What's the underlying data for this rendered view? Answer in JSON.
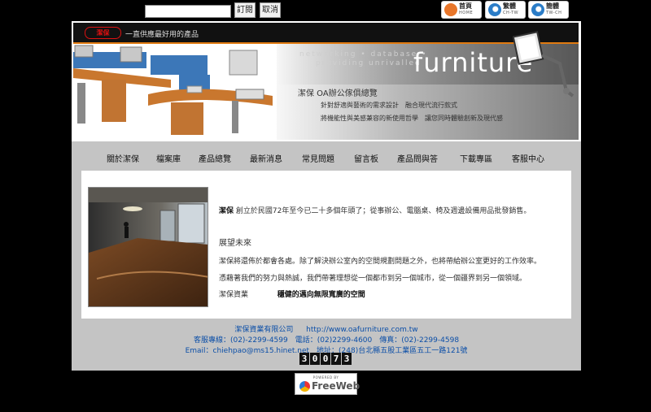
{
  "top": {
    "search_placeholder": "",
    "order_button": "訂閱",
    "cancel_button": "取消",
    "lang": [
      {
        "label": "首頁",
        "sub": "HOME",
        "icon": "home-icon",
        "color": "#e8762a"
      },
      {
        "label": "繁體",
        "sub": "CH-TW",
        "icon": "traditional-chinese-icon",
        "color": "#2a7cc7"
      },
      {
        "label": "簡體",
        "sub": "TW-CH",
        "icon": "simplified-chinese-icon",
        "color": "#2a7cc7"
      }
    ]
  },
  "header": {
    "logo": "潔保",
    "slogan": "一直供應最好用的產品",
    "tagline1": "networking • database •",
    "tagline2": "providing unrivalled",
    "word": "furniture",
    "title": "潔保 OA辦公傢俱總覽",
    "line1": "針對舒適與藝術的需求設計　融合現代流行款式",
    "line2": "將機能性與美感兼容的新使用哲學　讓您同時體驗創新及現代感"
  },
  "nav": {
    "items": [
      "關於潔保",
      "檔案庫",
      "產品總覽",
      "最新消息",
      "常見問題",
      "留言板",
      "產品問與答",
      "下載專區",
      "客服中心"
    ]
  },
  "content": {
    "p1_brand": "潔保",
    "p1_mid": "創立於民國",
    "p1_rest": "72年至今已二十多個年頭了；從事辦公、電腦桌、椅及週邊設備用品批發銷售。",
    "heading": "展望未來",
    "p2": "潔保將還佈於都會各處。除了解決辦公室內的空間規劃問題之外，也將帶給辦公室更好的工作效率。",
    "p3": "憑藉著我們的努力與熱誠，我們帶著理想從一個都市到另一個城市，從一個疆界到另一個領域。",
    "p4_a": "潔保資業",
    "p4_b": "穩健的邁向無限寬廣的空間"
  },
  "footer": {
    "company": "潔保資業有限公司",
    "url": "http://www.oafurniture.com.tw",
    "phone_line": "客服專線：(02)-2299-4599　電話：(02)2299-4600　傳真：(02)-2299-4598",
    "email_line": "Email：chiehpao@ms15.hinet.net　地址：(248)台北縣五股工業區五工一路121號",
    "counter": [
      "3",
      "0",
      "0",
      "7",
      "3"
    ]
  },
  "badge": {
    "powered": "POWERED BY",
    "name": "FreeWeb"
  }
}
